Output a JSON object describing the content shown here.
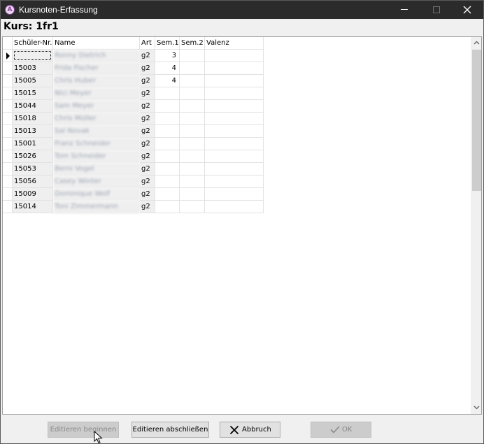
{
  "window": {
    "title": "Kursnoten-Erfassung",
    "icon": "app-logo-icon",
    "icon_letter": "A",
    "controls": [
      "minimize-icon",
      "maximize-icon",
      "close-icon"
    ]
  },
  "course": {
    "title": "Kurs: 1fr1"
  },
  "grid": {
    "columns": [
      "Schüler-Nr.",
      "Name",
      "Art",
      "Sem.1",
      "Sem.2",
      "Valenz"
    ],
    "rows": [
      {
        "nr": "",
        "name": "Ronny Dietrich",
        "art": "g2",
        "sem1": "3",
        "sem2": "",
        "valenz": ""
      },
      {
        "nr": "15003",
        "name": "Frida Fischer",
        "art": "g2",
        "sem1": "4",
        "sem2": "",
        "valenz": ""
      },
      {
        "nr": "15005",
        "name": "Chris Huber",
        "art": "g2",
        "sem1": "4",
        "sem2": "",
        "valenz": ""
      },
      {
        "nr": "15015",
        "name": "Nici Meyer",
        "art": "g2",
        "sem1": "",
        "sem2": "",
        "valenz": ""
      },
      {
        "nr": "15044",
        "name": "Sam Meyer",
        "art": "g2",
        "sem1": "",
        "sem2": "",
        "valenz": ""
      },
      {
        "nr": "15018",
        "name": "Chris Müller",
        "art": "g2",
        "sem1": "",
        "sem2": "",
        "valenz": ""
      },
      {
        "nr": "15013",
        "name": "Sal Novak",
        "art": "g2",
        "sem1": "",
        "sem2": "",
        "valenz": ""
      },
      {
        "nr": "15001",
        "name": "Franz Schneider",
        "art": "g2",
        "sem1": "",
        "sem2": "",
        "valenz": ""
      },
      {
        "nr": "15026",
        "name": "Tom Schneider",
        "art": "g2",
        "sem1": "",
        "sem2": "",
        "valenz": ""
      },
      {
        "nr": "15053",
        "name": "Berni Vogel",
        "art": "g2",
        "sem1": "",
        "sem2": "",
        "valenz": ""
      },
      {
        "nr": "15056",
        "name": "Casey Winter",
        "art": "g2",
        "sem1": "",
        "sem2": "",
        "valenz": ""
      },
      {
        "nr": "15009",
        "name": "Dominique Wolf",
        "art": "g2",
        "sem1": "",
        "sem2": "",
        "valenz": ""
      },
      {
        "nr": "15014",
        "name": "Toni Zimmermann",
        "art": "g2",
        "sem1": "",
        "sem2": "",
        "valenz": ""
      }
    ]
  },
  "buttons": {
    "edit_start": "Editieren beginnen",
    "edit_end": "Editieren abschließen",
    "cancel": "Abbruch",
    "ok": "OK"
  },
  "colors": {
    "titlebar": "#2b2b2b",
    "grey_cell": "#efefef",
    "grid_line": "#e2e2e2",
    "disabled_text": "#8a8a8a"
  }
}
